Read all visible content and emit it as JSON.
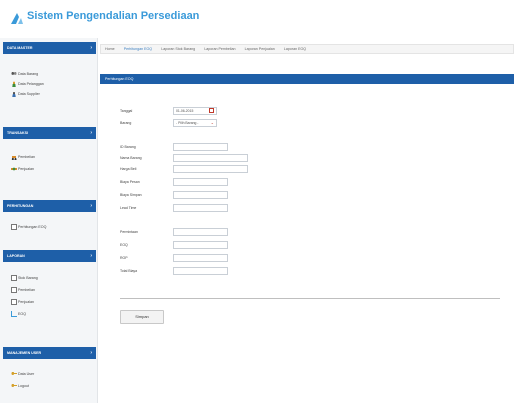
{
  "app": {
    "title": "Sistem Pengendalian Persediaan"
  },
  "sidebar": {
    "sections": [
      {
        "title": "DATA MASTER",
        "items": [
          "Data Barang",
          "Data Pelanggan",
          "Data Supplier"
        ]
      },
      {
        "title": "TRANSAKSI",
        "items": [
          "Pembelian",
          "Penjualan"
        ]
      },
      {
        "title": "PERHITUNGAN",
        "items": [
          "Perhitungan EOQ"
        ]
      },
      {
        "title": "LAPORAN",
        "items": [
          "Stok Barang",
          "Pembelian",
          "Penjualan",
          "EOQ"
        ]
      },
      {
        "title": "MANAJEMEN USER",
        "items": [
          "Data User",
          "Logout"
        ]
      }
    ]
  },
  "breadcrumb": [
    "Home",
    "Perhitungan EOQ",
    "Laporan Stok Barang",
    "Laporan Pembelian",
    "Laporan Penjualan",
    "Laporan EOQ"
  ],
  "form": {
    "header": "Perhitungan EOQ",
    "tanggal": {
      "label": "Tanggal",
      "value": "01-06-2015"
    },
    "barang": {
      "label": "Barang",
      "value": "- Pilih Barang -"
    },
    "fields": [
      {
        "label": "ID Barang",
        "value": ""
      },
      {
        "label": "Nama Barang",
        "value": ""
      },
      {
        "label": "Harga Beli",
        "value": ""
      },
      {
        "label": "Biaya Pesan",
        "value": ""
      },
      {
        "label": "Biaya Simpan",
        "value": ""
      },
      {
        "label": "Lead Time",
        "value": ""
      },
      {
        "label": "Permintaan",
        "value": ""
      },
      {
        "label": "EOQ",
        "value": ""
      },
      {
        "label": "ROP",
        "value": ""
      },
      {
        "label": "Total Biaya",
        "value": ""
      }
    ],
    "submit_label": "Simpan"
  },
  "colors": {
    "accent": "#1e5fa8",
    "title": "#3a9ad9"
  },
  "icons": {
    "logo": "app-logo-icon",
    "sidebar": [
      "users-icon",
      "person-icon",
      "supplier-icon",
      "cart-icon",
      "sale-icon",
      "document-icon",
      "document-icon",
      "document-icon",
      "document-icon",
      "chart-icon",
      "key-icon",
      "key-icon"
    ]
  }
}
